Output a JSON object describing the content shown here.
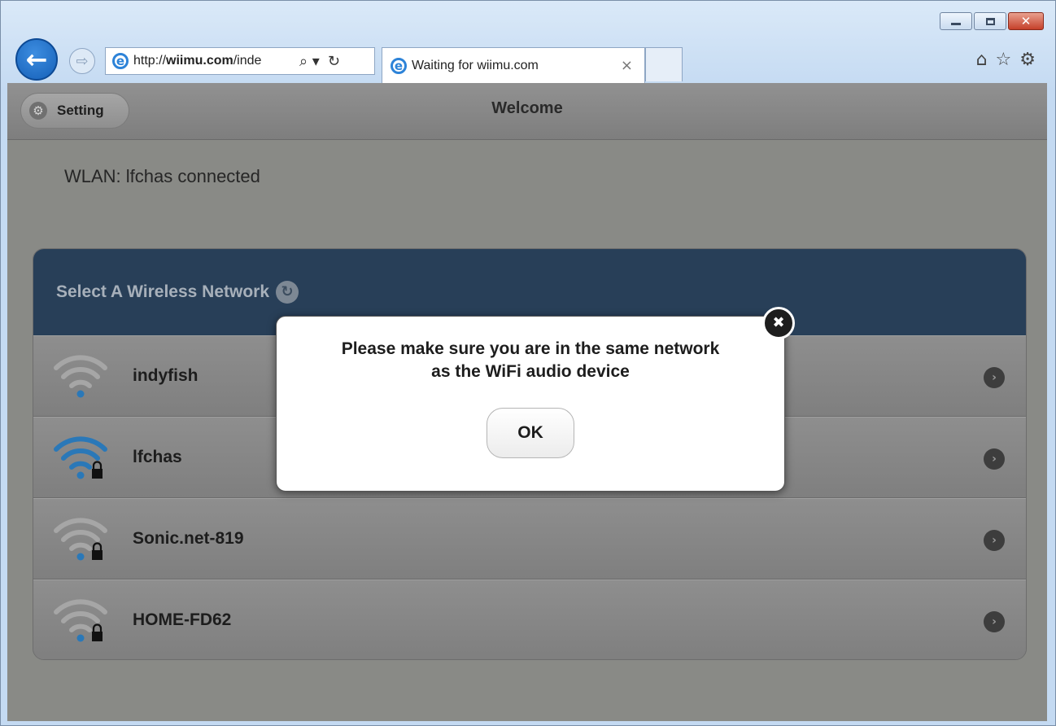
{
  "browser": {
    "url_prefix": "http://",
    "url_host": "wiimu.com",
    "url_path": "/inde",
    "tab_title": "Waiting for wiimu.com",
    "tab_close_glyph": "×",
    "back_glyph": "←",
    "forward_glyph": "⇨",
    "search_glyph": "⌕ ▾",
    "refresh_glyph": "↻",
    "toolbar_glyphs": [
      "⌂",
      "☆",
      "⚙"
    ],
    "window_close_glyph": "✕"
  },
  "app": {
    "setting_label": "Setting",
    "title": "Welcome",
    "wlan_status": "WLAN: lfchas connected"
  },
  "network_panel": {
    "header": "Select A Wireless Network",
    "networks": [
      {
        "name": "indyfish",
        "locked": false,
        "signal_color": "#a6a6a6"
      },
      {
        "name": "lfchas",
        "locked": true,
        "signal_color": "#2a78b8"
      },
      {
        "name": "Sonic.net-819",
        "locked": true,
        "signal_color": "#a6a6a6"
      },
      {
        "name": "HOME-FD62",
        "locked": true,
        "signal_color": "#a6a6a6"
      }
    ]
  },
  "modal": {
    "message_line1": "Please make sure you are in the same network",
    "message_line2": "as the WiFi audio device",
    "ok_label": "OK",
    "close_glyph": "✖"
  }
}
